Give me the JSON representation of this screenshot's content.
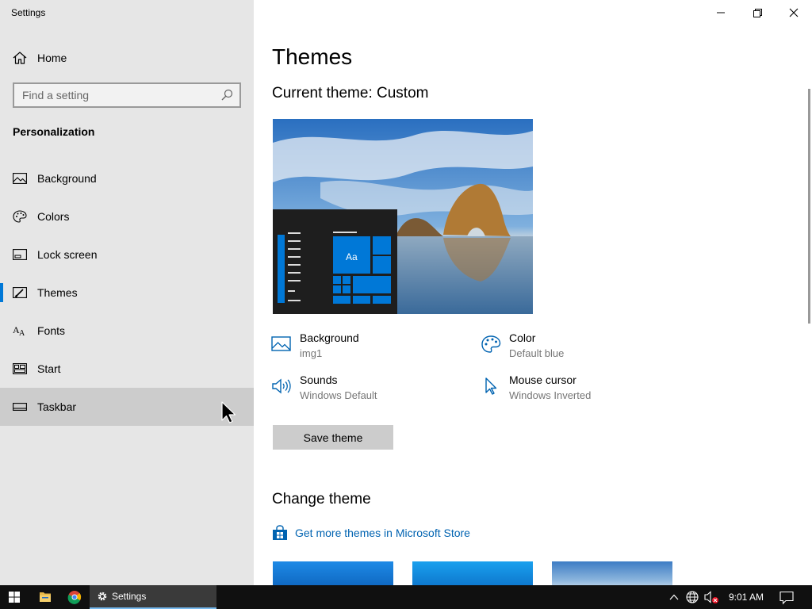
{
  "app": {
    "title": "Settings"
  },
  "sidebar": {
    "home_label": "Home",
    "search_placeholder": "Find a setting",
    "section_title": "Personalization",
    "items": [
      {
        "label": "Background",
        "icon": "picture-icon"
      },
      {
        "label": "Colors",
        "icon": "palette-icon"
      },
      {
        "label": "Lock screen",
        "icon": "lock-screen-icon"
      },
      {
        "label": "Themes",
        "icon": "brush-icon",
        "active": true
      },
      {
        "label": "Fonts",
        "icon": "fonts-icon"
      },
      {
        "label": "Start",
        "icon": "start-icon"
      },
      {
        "label": "Taskbar",
        "icon": "taskbar-icon",
        "hover": true
      }
    ]
  },
  "main": {
    "page_title": "Themes",
    "current_theme": "Current theme: Custom",
    "preview_tile_text": "Aa",
    "properties": [
      {
        "name": "Background",
        "value": "img1",
        "icon": "picture-icon"
      },
      {
        "name": "Color",
        "value": "Default blue",
        "icon": "palette-icon"
      },
      {
        "name": "Sounds",
        "value": "Windows Default",
        "icon": "speaker-icon"
      },
      {
        "name": "Mouse cursor",
        "value": "Windows Inverted",
        "icon": "cursor-icon"
      }
    ],
    "save_label": "Save theme",
    "change_title": "Change theme",
    "store_link": "Get more themes in Microsoft Store"
  },
  "taskbar": {
    "settings_label": "Settings",
    "clock": "9:01 AM"
  },
  "colors": {
    "accent": "#0078d7",
    "link": "#0063b1",
    "sidebar_bg": "#e6e6e6",
    "taskbar_bg": "#101010"
  }
}
